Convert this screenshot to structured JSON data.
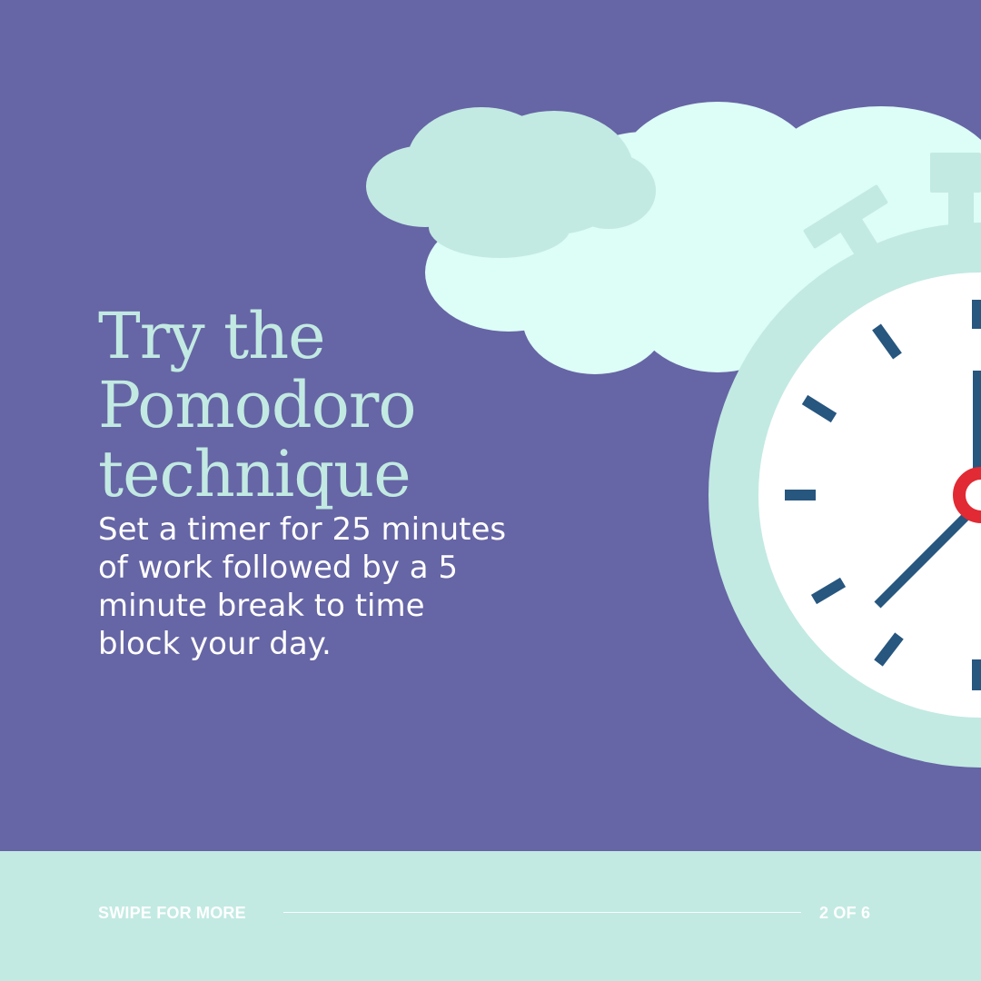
{
  "slide": {
    "headline_lines": [
      "Try the",
      "Pomodoro",
      "technique"
    ],
    "body_lines": [
      "Set a timer for 25 minutes",
      "of work followed by a 5",
      "minute break to time",
      "block your day."
    ]
  },
  "footer": {
    "swipe_label": "SWIPE FOR MORE",
    "page_counter": "2 OF 6"
  },
  "colors": {
    "background": "#6665a5",
    "accent_mint": "#c2eae2",
    "cloud_light": "#ddfdf7",
    "clock_face": "#ffffff",
    "clock_marks": "#27567f",
    "clock_center": "#e12a34",
    "footer_text": "#ffffff"
  },
  "icons": {
    "illustration": "stopwatch-clock-icon",
    "cloud": "cloud-icon"
  }
}
